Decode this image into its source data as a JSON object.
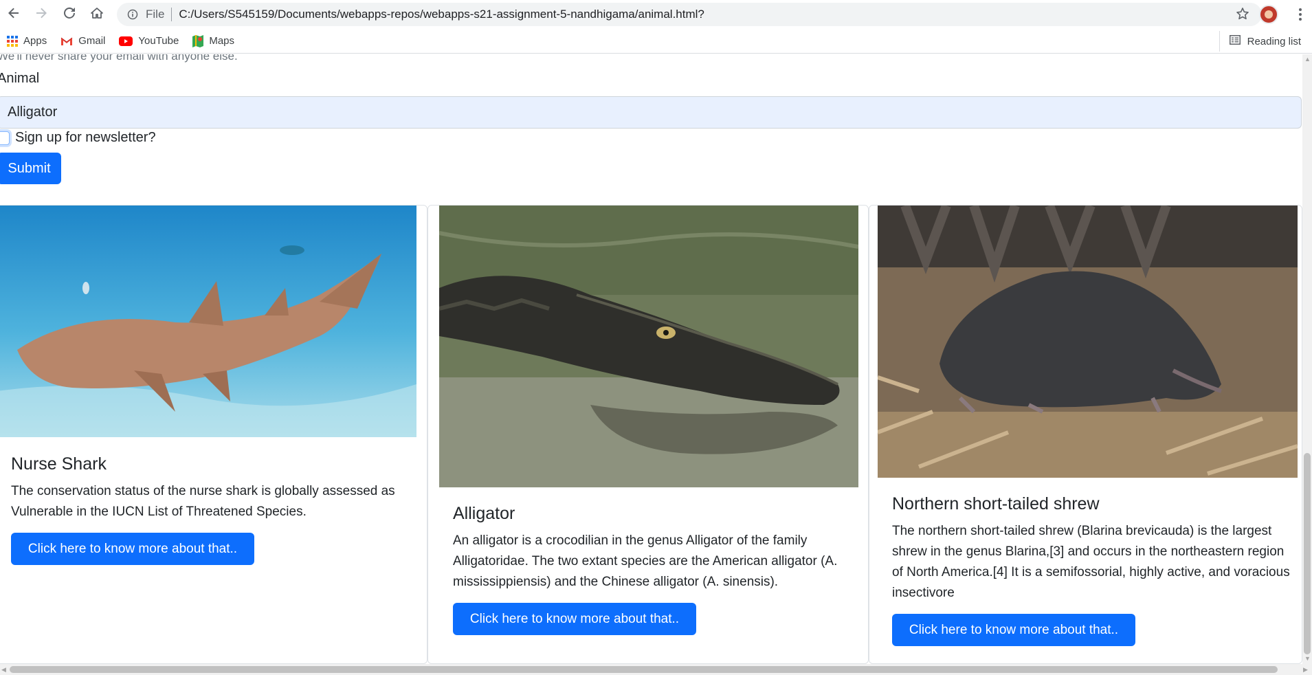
{
  "browser": {
    "scheme_label": "File",
    "url": "C:/Users/S545159/Documents/webapps-repos/webapps-s21-assignment-5-nandhigama/animal.html?",
    "bookmarks": [
      {
        "label": "Apps",
        "icon": "apps-grid-icon"
      },
      {
        "label": "Gmail",
        "icon": "gmail-icon"
      },
      {
        "label": "YouTube",
        "icon": "youtube-icon"
      },
      {
        "label": "Maps",
        "icon": "maps-icon"
      }
    ],
    "reading_list_label": "Reading list"
  },
  "form": {
    "email_help": "We'll never share your email with anyone else.",
    "animal_label": "Animal",
    "animal_value": "Alligator",
    "newsletter_label": "Sign up for newsletter?",
    "newsletter_checked": false,
    "submit_label": "Submit"
  },
  "cards": [
    {
      "title": "Nurse Shark",
      "text": "The conservation status of the nurse shark is globally assessed as Vulnerable in the IUCN List of Threatened Species.",
      "button": "Click here to know more about that..",
      "image": "nurse-shark-photo"
    },
    {
      "title": "Alligator",
      "text": "An alligator is a crocodilian in the genus Alligator of the family Alligatoridae. The two extant species are the American alligator (A. mississippiensis) and the Chinese alligator (A. sinensis).",
      "button": "Click here to know more about that..",
      "image": "alligator-photo"
    },
    {
      "title": "Northern short-tailed shrew",
      "text": "The northern short-tailed shrew (Blarina brevicauda) is the largest shrew in the genus Blarina,[3] and occurs in the northeastern region of North America.[4] It is a semifossorial, highly active, and voracious insectivore",
      "button": "Click here to know more about that..",
      "image": "shrew-photo"
    }
  ],
  "colors": {
    "primary": "#0d6efd",
    "autofill": "#e8f0fe",
    "muted": "#6c757d"
  }
}
